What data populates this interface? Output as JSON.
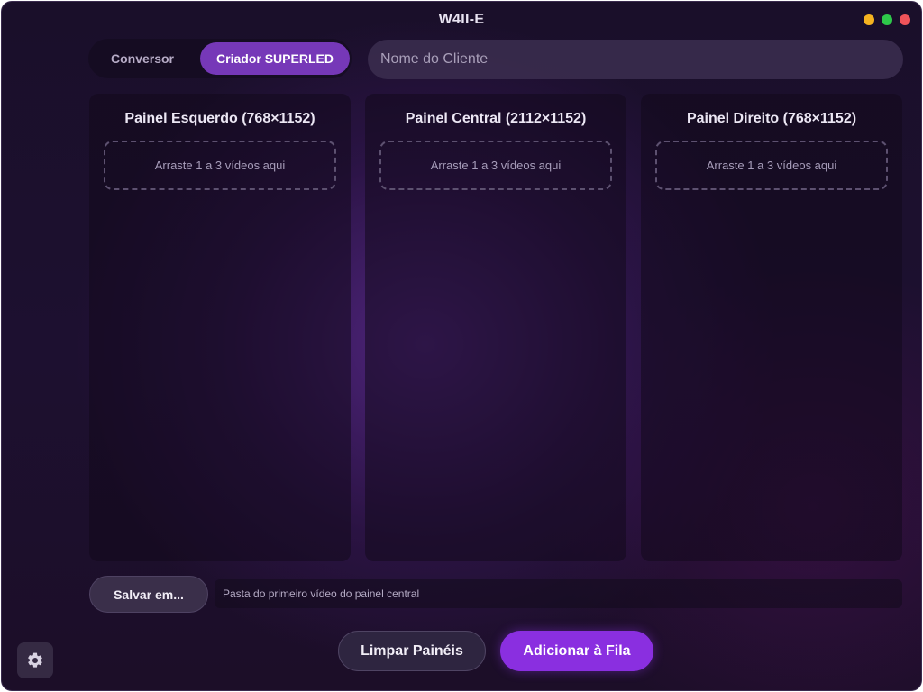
{
  "window": {
    "title": "W4II-E",
    "controls": [
      "minimize",
      "maximize",
      "close"
    ]
  },
  "mode_tabs": {
    "items": [
      {
        "label": "Conversor",
        "active": false
      },
      {
        "label": "Criador SUPERLED",
        "active": true
      }
    ]
  },
  "client_name": {
    "value": "",
    "placeholder": "Nome do Cliente"
  },
  "panels": [
    {
      "title": "Painel Esquerdo (768×1152)",
      "dropzone": "Arraste 1 a 3 vídeos aqui"
    },
    {
      "title": "Painel Central (2112×1152)",
      "dropzone": "Arraste 1 a 3 vídeos aqui"
    },
    {
      "title": "Painel Direito (768×1152)",
      "dropzone": "Arraste 1 a 3 vídeos aqui"
    }
  ],
  "save": {
    "button_label": "Salvar em...",
    "path_text": "Pasta do primeiro vídeo do painel central"
  },
  "actions": {
    "clear_label": "Limpar Painéis",
    "queue_label": "Adicionar à Fila"
  },
  "settings": {
    "icon": "gear-icon"
  },
  "colors": {
    "accent": "#8a2fe0",
    "active_tab": "#7638b8",
    "traffic_minimize": "#f5b320",
    "traffic_maximize": "#2ec84a",
    "traffic_close": "#f0545a"
  }
}
